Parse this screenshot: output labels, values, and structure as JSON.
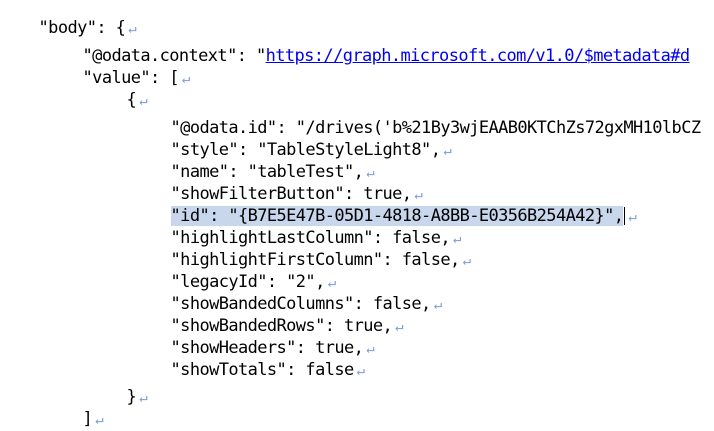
{
  "editor": {
    "return_mark": "↵",
    "lines": {
      "l0": {
        "indent": "",
        "text": "\"body\": {"
      },
      "l1_prefix": "\"@odata.context\": \"",
      "l1_link": "https://graph.microsoft.com/v1.0/$metadata#d",
      "l2": {
        "text": "\"value\": ["
      },
      "l3": {
        "text": "{"
      },
      "l4": {
        "text": "\"@odata.id\": \"/drives('b%21By3wjEAAB0KTChZs72gxMH10lbCZ"
      },
      "l5": {
        "text": "\"style\": \"TableStyleLight8\","
      },
      "l6": {
        "text": "\"name\": \"tableTest\","
      },
      "l7": {
        "text": "\"showFilterButton\": true,"
      },
      "l8": {
        "text": "\"id\": \"{B7E5E47B-05D1-4818-A8BB-E0356B254A42}\","
      },
      "l9": {
        "text": "\"highlightLastColumn\": false,"
      },
      "l10": {
        "text": "\"highlightFirstColumn\": false,"
      },
      "l11": {
        "text": "\"legacyId\": \"2\","
      },
      "l12": {
        "text": "\"showBandedColumns\": false,"
      },
      "l13": {
        "text": "\"showBandedRows\": true,"
      },
      "l14": {
        "text": "\"showHeaders\": true,"
      },
      "l15": {
        "text": "\"showTotals\": false"
      },
      "l16": {
        "text": "}"
      },
      "l17": {
        "text": "]"
      },
      "l18": {
        "text": "}"
      }
    }
  }
}
